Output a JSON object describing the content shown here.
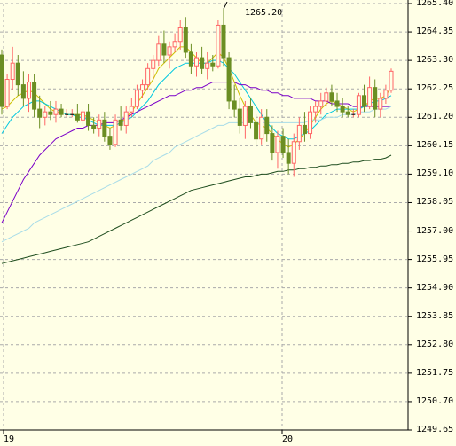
{
  "chart_data": {
    "type": "candlestick",
    "title": "",
    "y_axis": {
      "min": 1249.65,
      "max": 1265.4,
      "tick_labels": [
        "1265.40",
        "1264.35",
        "1263.30",
        "1262.25",
        "1261.20",
        "1260.15",
        "1259.10",
        "1258.05",
        "1257.00",
        "1255.95",
        "1254.90",
        "1253.85",
        "1252.80",
        "1251.75",
        "1250.70",
        "1249.65"
      ]
    },
    "x_axis": {
      "tick_labels": [
        "19",
        "20"
      ]
    },
    "annotations": [
      {
        "text": "1265.20",
        "value": 1265.2
      }
    ],
    "candles": [
      [
        1263.5,
        1263.7,
        1261.3,
        1261.6
      ],
      [
        1261.6,
        1262.8,
        1261.5,
        1262.6
      ],
      [
        1262.6,
        1263.8,
        1262.2,
        1263.2
      ],
      [
        1263.2,
        1263.5,
        1262.0,
        1262.4
      ],
      [
        1262.4,
        1262.9,
        1261.6,
        1261.9
      ],
      [
        1261.9,
        1262.8,
        1261.4,
        1262.5
      ],
      [
        1262.5,
        1262.8,
        1261.2,
        1261.5
      ],
      [
        1261.5,
        1262.0,
        1260.8,
        1261.2
      ],
      [
        1261.2,
        1261.6,
        1260.9,
        1261.4
      ],
      [
        1261.4,
        1261.8,
        1261.1,
        1261.3
      ],
      [
        1261.3,
        1261.8,
        1261.0,
        1261.5
      ],
      [
        1261.5,
        1261.7,
        1261.2,
        1261.3
      ],
      [
        1261.3,
        1261.5,
        1261.2,
        1261.3
      ],
      [
        1261.3,
        1261.5,
        1261.2,
        1261.3
      ],
      [
        1261.3,
        1261.7,
        1261.0,
        1261.1
      ],
      [
        1261.1,
        1261.5,
        1260.9,
        1261.4
      ],
      [
        1261.4,
        1261.7,
        1260.7,
        1260.9
      ],
      [
        1260.9,
        1261.2,
        1260.6,
        1260.8
      ],
      [
        1260.8,
        1261.3,
        1260.5,
        1261.1
      ],
      [
        1261.1,
        1261.4,
        1260.3,
        1260.5
      ],
      [
        1260.5,
        1260.8,
        1260.0,
        1260.2
      ],
      [
        1260.2,
        1261.3,
        1260.1,
        1261.1
      ],
      [
        1261.1,
        1261.6,
        1260.7,
        1260.9
      ],
      [
        1260.9,
        1261.6,
        1260.6,
        1261.4
      ],
      [
        1261.4,
        1261.9,
        1261.2,
        1261.6
      ],
      [
        1261.6,
        1262.4,
        1261.5,
        1262.2
      ],
      [
        1262.2,
        1262.6,
        1261.9,
        1262.4
      ],
      [
        1262.4,
        1263.2,
        1262.2,
        1263.0
      ],
      [
        1263.0,
        1263.5,
        1262.6,
        1263.3
      ],
      [
        1263.3,
        1264.2,
        1263.1,
        1263.9
      ],
      [
        1263.9,
        1264.4,
        1263.2,
        1263.5
      ],
      [
        1263.5,
        1264.0,
        1263.0,
        1263.8
      ],
      [
        1263.8,
        1264.3,
        1263.6,
        1264.0
      ],
      [
        1264.0,
        1264.8,
        1263.7,
        1264.5
      ],
      [
        1264.5,
        1264.9,
        1263.4,
        1263.6
      ],
      [
        1263.6,
        1263.9,
        1262.8,
        1263.1
      ],
      [
        1263.1,
        1263.6,
        1262.7,
        1263.4
      ],
      [
        1263.4,
        1263.8,
        1262.8,
        1263.0
      ],
      [
        1263.0,
        1263.6,
        1262.6,
        1263.2
      ],
      [
        1263.2,
        1263.5,
        1262.9,
        1263.1
      ],
      [
        1263.1,
        1264.8,
        1263.0,
        1264.6
      ],
      [
        1264.6,
        1265.2,
        1263.1,
        1263.4
      ],
      [
        1263.4,
        1263.6,
        1261.5,
        1261.8
      ],
      [
        1261.8,
        1262.4,
        1261.2,
        1261.5
      ],
      [
        1261.5,
        1261.9,
        1260.6,
        1260.9
      ],
      [
        1260.9,
        1261.8,
        1260.4,
        1261.6
      ],
      [
        1261.6,
        1261.9,
        1260.8,
        1261.0
      ],
      [
        1261.0,
        1261.3,
        1260.1,
        1260.4
      ],
      [
        1260.4,
        1261.5,
        1260.2,
        1261.2
      ],
      [
        1261.2,
        1261.5,
        1260.3,
        1260.6
      ],
      [
        1260.6,
        1260.9,
        1259.6,
        1259.9
      ],
      [
        1259.9,
        1260.7,
        1259.3,
        1260.5
      ],
      [
        1260.5,
        1260.8,
        1259.7,
        1259.9
      ],
      [
        1259.9,
        1260.4,
        1259.1,
        1259.5
      ],
      [
        1259.5,
        1260.6,
        1259.0,
        1260.3
      ],
      [
        1260.3,
        1261.2,
        1260.0,
        1260.9
      ],
      [
        1260.9,
        1261.4,
        1260.3,
        1260.6
      ],
      [
        1260.6,
        1261.6,
        1260.4,
        1261.4
      ],
      [
        1261.4,
        1261.8,
        1261.0,
        1261.6
      ],
      [
        1261.6,
        1262.1,
        1261.3,
        1261.8
      ],
      [
        1261.8,
        1262.3,
        1261.6,
        1262.1
      ],
      [
        1262.1,
        1262.4,
        1261.6,
        1261.8
      ],
      [
        1261.8,
        1262.1,
        1261.4,
        1261.6
      ],
      [
        1261.6,
        1261.9,
        1261.2,
        1261.4
      ],
      [
        1261.4,
        1261.6,
        1261.2,
        1261.3
      ],
      [
        1261.3,
        1261.5,
        1261.2,
        1261.3
      ],
      [
        1261.3,
        1262.1,
        1261.2,
        1262.0
      ],
      [
        1262.0,
        1262.4,
        1261.4,
        1261.6
      ],
      [
        1261.6,
        1262.7,
        1261.5,
        1262.3
      ],
      [
        1262.3,
        1262.6,
        1261.2,
        1261.5
      ],
      [
        1261.5,
        1262.1,
        1261.2,
        1261.9
      ],
      [
        1261.9,
        1262.4,
        1261.7,
        1262.2
      ],
      [
        1262.2,
        1263.0,
        1262.1,
        1262.9
      ]
    ],
    "moving_averages": [
      {
        "color": "#ccc000",
        "values": [
          1261.5,
          1261.6,
          1261.8,
          1262.0,
          1262.1,
          1262.2,
          1262.1,
          1261.9,
          1261.7,
          1261.5,
          1261.4,
          1261.4,
          1261.3,
          1261.3,
          1261.3,
          1261.3,
          1261.2,
          1261.1,
          1261.0,
          1260.9,
          1260.8,
          1260.9,
          1261.0,
          1261.2,
          1261.4,
          1261.7,
          1262.0,
          1262.3,
          1262.6,
          1263.0,
          1263.2,
          1263.4,
          1263.6,
          1263.8,
          1263.8,
          1263.6,
          1263.4,
          1263.2,
          1263.2,
          1263.4,
          1263.6,
          1263.4,
          1263.0,
          1262.5,
          1262.0,
          1261.6,
          1261.3,
          1261.0,
          1260.9,
          1260.8,
          1260.6,
          1260.4,
          1260.2,
          1260.1,
          1260.2,
          1260.4,
          1260.6,
          1260.9,
          1261.2,
          1261.5,
          1261.7,
          1261.8,
          1261.7,
          1261.6,
          1261.5,
          1261.4,
          1261.5,
          1261.6,
          1261.8,
          1261.9,
          1261.9,
          1262.0,
          1262.3
        ]
      },
      {
        "color": "#00c8e0",
        "values": [
          1260.6,
          1260.9,
          1261.2,
          1261.4,
          1261.6,
          1261.7,
          1261.8,
          1261.8,
          1261.7,
          1261.6,
          1261.5,
          1261.4,
          1261.3,
          1261.3,
          1261.2,
          1261.2,
          1261.1,
          1261.0,
          1260.9,
          1260.9,
          1260.9,
          1260.9,
          1261.0,
          1261.1,
          1261.2,
          1261.4,
          1261.6,
          1261.8,
          1262.1,
          1262.4,
          1262.6,
          1262.8,
          1263.0,
          1263.1,
          1263.2,
          1263.2,
          1263.2,
          1263.2,
          1263.2,
          1263.3,
          1263.3,
          1263.2,
          1263.0,
          1262.8,
          1262.5,
          1262.2,
          1261.9,
          1261.6,
          1261.3,
          1261.0,
          1260.8,
          1260.6,
          1260.5,
          1260.4,
          1260.4,
          1260.5,
          1260.6,
          1260.7,
          1260.9,
          1261.1,
          1261.3,
          1261.4,
          1261.5,
          1261.5,
          1261.5,
          1261.5,
          1261.5,
          1261.6,
          1261.7,
          1261.8,
          1261.8,
          1261.9,
          1262.0
        ]
      },
      {
        "color": "#7b00c8",
        "values": [
          1257.3,
          1257.7,
          1258.1,
          1258.5,
          1258.9,
          1259.2,
          1259.5,
          1259.8,
          1260.0,
          1260.2,
          1260.4,
          1260.5,
          1260.6,
          1260.7,
          1260.8,
          1260.8,
          1260.9,
          1260.9,
          1260.9,
          1261.0,
          1261.0,
          1261.0,
          1261.1,
          1261.2,
          1261.3,
          1261.4,
          1261.5,
          1261.6,
          1261.7,
          1261.8,
          1261.9,
          1262.0,
          1262.0,
          1262.1,
          1262.2,
          1262.2,
          1262.3,
          1262.3,
          1262.4,
          1262.5,
          1262.5,
          1262.5,
          1262.5,
          1262.5,
          1262.4,
          1262.4,
          1262.3,
          1262.3,
          1262.2,
          1262.2,
          1262.1,
          1262.1,
          1262.0,
          1262.0,
          1261.9,
          1261.9,
          1261.9,
          1261.9,
          1261.8,
          1261.8,
          1261.8,
          1261.7,
          1261.7,
          1261.7,
          1261.7,
          1261.6,
          1261.6,
          1261.6,
          1261.6,
          1261.6,
          1261.6,
          1261.6,
          1261.6
        ]
      },
      {
        "color": "#a8dce8",
        "values": [
          1256.6,
          1256.7,
          1256.8,
          1256.9,
          1257.0,
          1257.1,
          1257.3,
          1257.4,
          1257.5,
          1257.6,
          1257.7,
          1257.8,
          1257.9,
          1258.0,
          1258.1,
          1258.2,
          1258.3,
          1258.4,
          1258.5,
          1258.6,
          1258.7,
          1258.8,
          1258.9,
          1259.0,
          1259.1,
          1259.2,
          1259.3,
          1259.4,
          1259.6,
          1259.7,
          1259.8,
          1259.9,
          1260.1,
          1260.2,
          1260.3,
          1260.4,
          1260.5,
          1260.6,
          1260.7,
          1260.8,
          1260.9,
          1260.9,
          1261.0,
          1261.0,
          1261.0,
          1261.0,
          1261.0,
          1261.0,
          1261.0,
          1261.0,
          1261.0,
          1261.0,
          1261.0,
          1261.0,
          1261.0,
          1261.0,
          1261.0,
          1261.1,
          1261.1,
          1261.1,
          1261.2,
          1261.2,
          1261.2,
          1261.3,
          1261.3,
          1261.3,
          1261.4,
          1261.4,
          1261.4,
          1261.5,
          1261.5,
          1261.5,
          1261.6
        ]
      },
      {
        "color": "#1e4d1e",
        "values": [
          1255.8,
          1255.85,
          1255.9,
          1255.95,
          1256.0,
          1256.05,
          1256.1,
          1256.15,
          1256.2,
          1256.25,
          1256.3,
          1256.35,
          1256.4,
          1256.45,
          1256.5,
          1256.55,
          1256.6,
          1256.7,
          1256.8,
          1256.9,
          1257.0,
          1257.1,
          1257.2,
          1257.3,
          1257.4,
          1257.5,
          1257.6,
          1257.7,
          1257.8,
          1257.9,
          1258.0,
          1258.1,
          1258.2,
          1258.3,
          1258.4,
          1258.5,
          1258.55,
          1258.6,
          1258.65,
          1258.7,
          1258.75,
          1258.8,
          1258.85,
          1258.9,
          1258.95,
          1259.0,
          1259.0,
          1259.05,
          1259.1,
          1259.1,
          1259.15,
          1259.2,
          1259.2,
          1259.25,
          1259.25,
          1259.3,
          1259.3,
          1259.35,
          1259.35,
          1259.4,
          1259.4,
          1259.45,
          1259.45,
          1259.5,
          1259.5,
          1259.55,
          1259.55,
          1259.6,
          1259.6,
          1259.65,
          1259.65,
          1259.7,
          1259.8
        ]
      }
    ],
    "colors": {
      "background": "#ffffe6",
      "bull": "#ff6666",
      "bear": "#6b8e23",
      "grid": "#aaaaaa",
      "axis": "#000000"
    },
    "grid": true
  }
}
